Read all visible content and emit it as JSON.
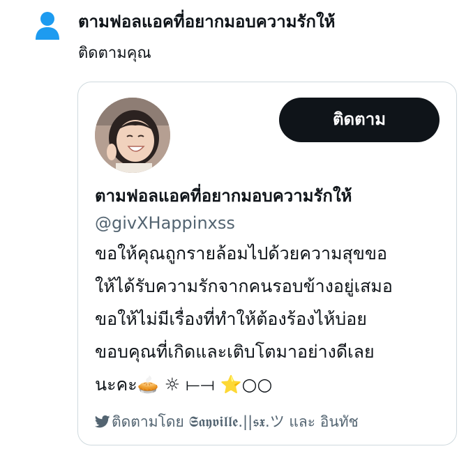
{
  "notification": {
    "title": "ตามฟอลแอคที่อยากมอบความรักให้",
    "subtitle": "ติดตามคุณ",
    "icon": "person-icon",
    "icon_color": "#1d9bf0"
  },
  "card": {
    "follow_button": "ติดตาม",
    "name": "ตามฟอลแอคที่อยากมอบความรักให้",
    "handle": "@givXHappinxss",
    "bio_lines": [
      "ขอให้คุณถูกรายล้อมไปด้วยความสุขขอ",
      "ให้ได้รับความรักจากคนรอบข้างอยู่เสมอ",
      "ขอให้ไม่มีเรื่องที่ทำให้ต้องร้องไห้บ่อย",
      "ขอบคุณที่เกิดและเติบโตมาอย่างดีเลย",
      "นะคะ🥧 ☼ ⟝⟞ ⭐○○"
    ],
    "followed_by_icon": "twitter-bird-icon",
    "followed_by": "ติดตามโดย 𝕾𝖆𝖞𝖛𝖎𝖑𝖑𝖊.||𝖘𝖝.ツ และ อินทัช"
  },
  "colors": {
    "button_bg": "#0f1419",
    "button_text": "#ffffff",
    "secondary_text": "#536471",
    "card_border": "#cfd9de",
    "accent": "#1d9bf0"
  }
}
